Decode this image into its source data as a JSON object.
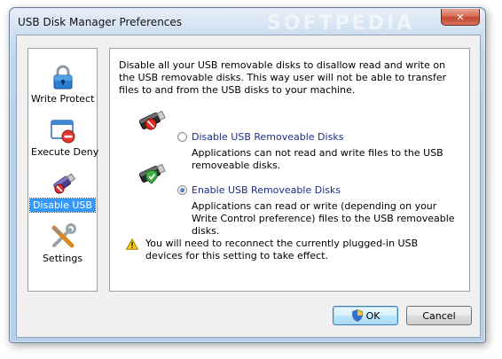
{
  "window": {
    "title": "USB Disk Manager Preferences",
    "watermark": "SOFTPEDIA",
    "close_glyph": "✕"
  },
  "sidebar": {
    "items": [
      {
        "label": "Write Protect",
        "icon": "padlock-icon",
        "selected": false
      },
      {
        "label": "Execute Deny",
        "icon": "window-deny-icon",
        "selected": false
      },
      {
        "label": "Disable USB",
        "icon": "usb-drive-icon",
        "selected": true
      },
      {
        "label": "Settings",
        "icon": "tools-icon",
        "selected": false
      }
    ]
  },
  "panel": {
    "description": "Disable all your USB removable disks to disallow read and write on the USB removable disks. This way user will not be able to transfer files to and from the USB disks to your machine.",
    "options": [
      {
        "label": "Disable USB Removeable Disks",
        "description": "Applications can not read and write files to the USB removeable disks.",
        "checked": false,
        "icon": "usb-disabled-icon"
      },
      {
        "label": "Enable USB Removeable Disks",
        "description": "Applications can read or write (depending on your Write Control preference) files to the USB removeable disks.",
        "checked": true,
        "icon": "usb-enabled-icon"
      }
    ],
    "warning": "You will need to reconnect the currently plugged-in USB devices for this setting to take effect."
  },
  "buttons": {
    "ok": "OK",
    "cancel": "Cancel"
  },
  "colors": {
    "selection": "#3399ff",
    "option_text": "#1b2f8a"
  }
}
